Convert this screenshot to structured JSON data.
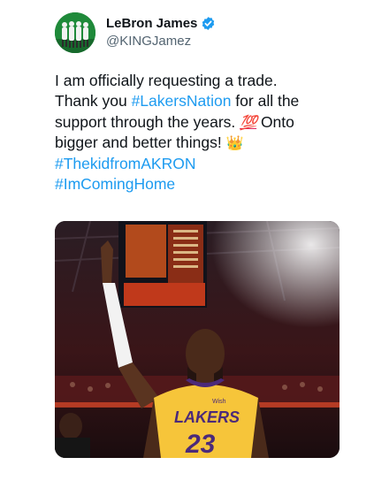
{
  "author": {
    "display_name": "LeBron James",
    "handle": "@KINGJamez",
    "verified_icon": "verified-badge-icon",
    "avatar_icon": "avatar-image"
  },
  "tweet": {
    "line1": "I am officially requesting a trade.",
    "line2_prefix": "Thank you ",
    "line2_hashtag": "#LakersNation",
    "line2_suffix": " for all the",
    "line3_text": "support through the years. ",
    "line3_emoji": "💯",
    "line3_suffix": " Onto",
    "line4_text": "bigger and better things! ",
    "line4_emoji": "👑",
    "hashtag2": "#ThekidfromAKRON",
    "hashtag3": "#ImComingHome"
  },
  "media": {
    "jersey_team": "LAKERS",
    "jersey_number": "23",
    "brand": "Wish"
  },
  "colors": {
    "hashtag": "#1d9bf0",
    "verified": "#1d9bf0",
    "jersey": "#f6c53a",
    "jersey_trim": "#4b2a7a"
  }
}
